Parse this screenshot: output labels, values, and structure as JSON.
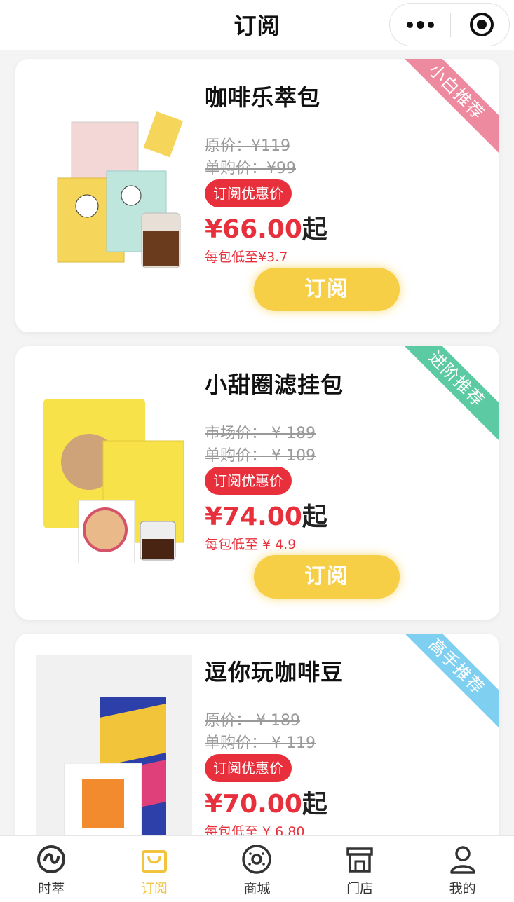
{
  "header": {
    "title": "订阅"
  },
  "products": [
    {
      "name": "咖啡乐萃包",
      "ribbon": "小白推荐",
      "ribbon_color": "#ee8aa0",
      "price_line_1": "原价：¥119",
      "price_line_2": "单购价：¥99",
      "badge": "订阅优惠价",
      "price": "¥66.00",
      "price_suffix": "起",
      "per_pack": "每包低至¥3.7",
      "button": "订阅"
    },
    {
      "name": "小甜圈滤挂包",
      "ribbon": "进阶推荐",
      "ribbon_color": "#5ccaa2",
      "price_line_1": "市场价： ¥ 189",
      "price_line_2": "单购价： ¥ 109",
      "badge": "订阅优惠价",
      "price": "¥74.00",
      "price_suffix": "起",
      "per_pack": "每包低至 ¥ 4.9",
      "button": "订阅"
    },
    {
      "name": "逗你玩咖啡豆",
      "ribbon": "高手推荐",
      "ribbon_color": "#7fd0f0",
      "price_line_1": "原价： ¥ 189",
      "price_line_2": "单购价： ¥ 119",
      "badge": "订阅优惠价",
      "price": "¥70.00",
      "price_suffix": "起",
      "per_pack": "每包低至 ¥ 6.80"
    }
  ],
  "tabbar": {
    "items": [
      {
        "label": "时萃",
        "icon": "brand-logo-icon"
      },
      {
        "label": "订阅",
        "icon": "shopping-bag-icon",
        "active": true
      },
      {
        "label": "商城",
        "icon": "donut-icon"
      },
      {
        "label": "门店",
        "icon": "store-icon"
      },
      {
        "label": "我的",
        "icon": "person-icon"
      }
    ],
    "active_color": "#f2c33d"
  }
}
